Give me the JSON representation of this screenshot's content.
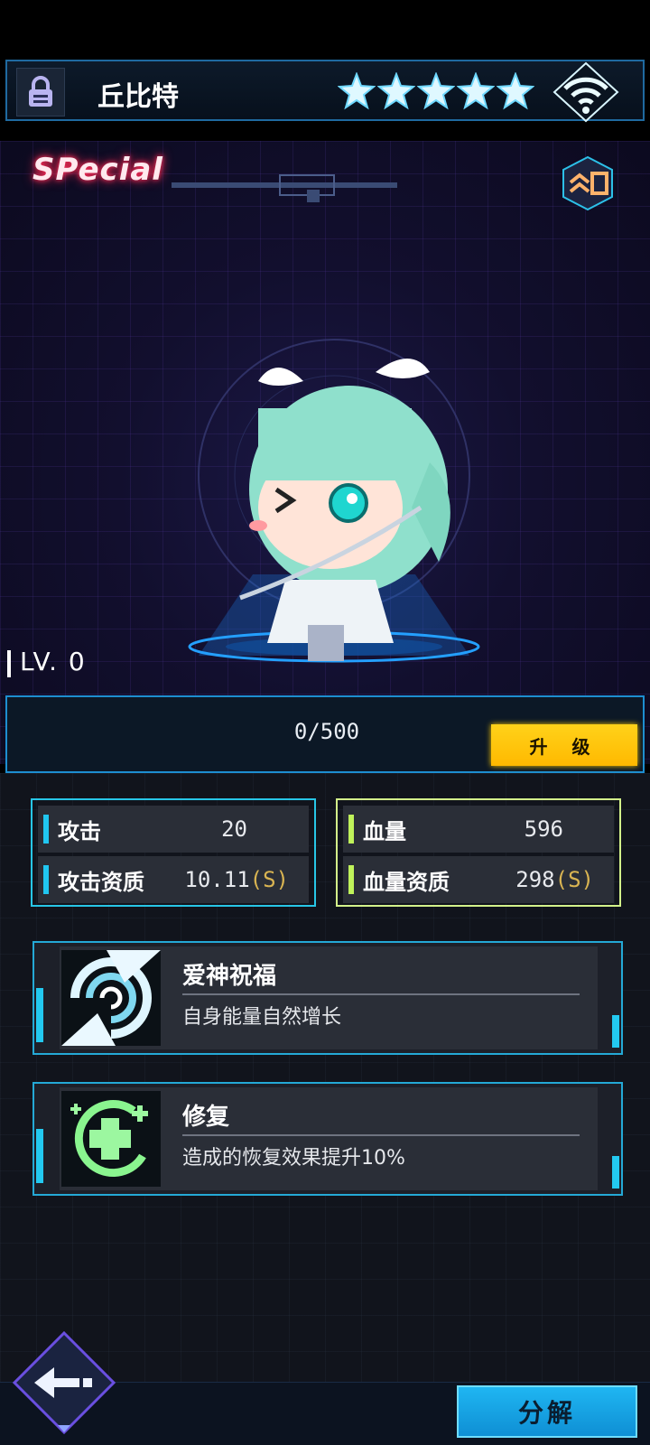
{
  "header": {
    "hero_name": "丘比特",
    "star_count": 5,
    "icons": [
      "lock-icon",
      "star-icon",
      "wifi-signal-icon"
    ]
  },
  "stage": {
    "quality_label": "SPecial",
    "level_label": "LV. 0",
    "rank_button_icon": "rank-up-chevron-icon"
  },
  "experience": {
    "progress_text": "0/500",
    "progress": 0,
    "upgrade_label": "升 级"
  },
  "stats": {
    "attack": {
      "label": "攻击",
      "value": "20"
    },
    "attack_aptitude": {
      "label": "攻击资质",
      "value": "10.11",
      "grade": "(S)"
    },
    "hp": {
      "label": "血量",
      "value": "596"
    },
    "hp_aptitude": {
      "label": "血量资质",
      "value": "298",
      "grade": "(S)"
    }
  },
  "skills": [
    {
      "name": "爱神祝福",
      "description": "自身能量自然增长",
      "icon": "swirl-icon"
    },
    {
      "name": "修复",
      "description": "造成的恢复效果提升10%",
      "icon": "heal-cross-icon"
    }
  ],
  "footer": {
    "back_icon": "back-arrow-icon",
    "decompose_label": "分解"
  },
  "colors": {
    "accent_cyan": "#27c6e6",
    "accent_green": "#d3f28a",
    "button_yellow": "#ffc400",
    "special_red": "#ff2b55"
  }
}
